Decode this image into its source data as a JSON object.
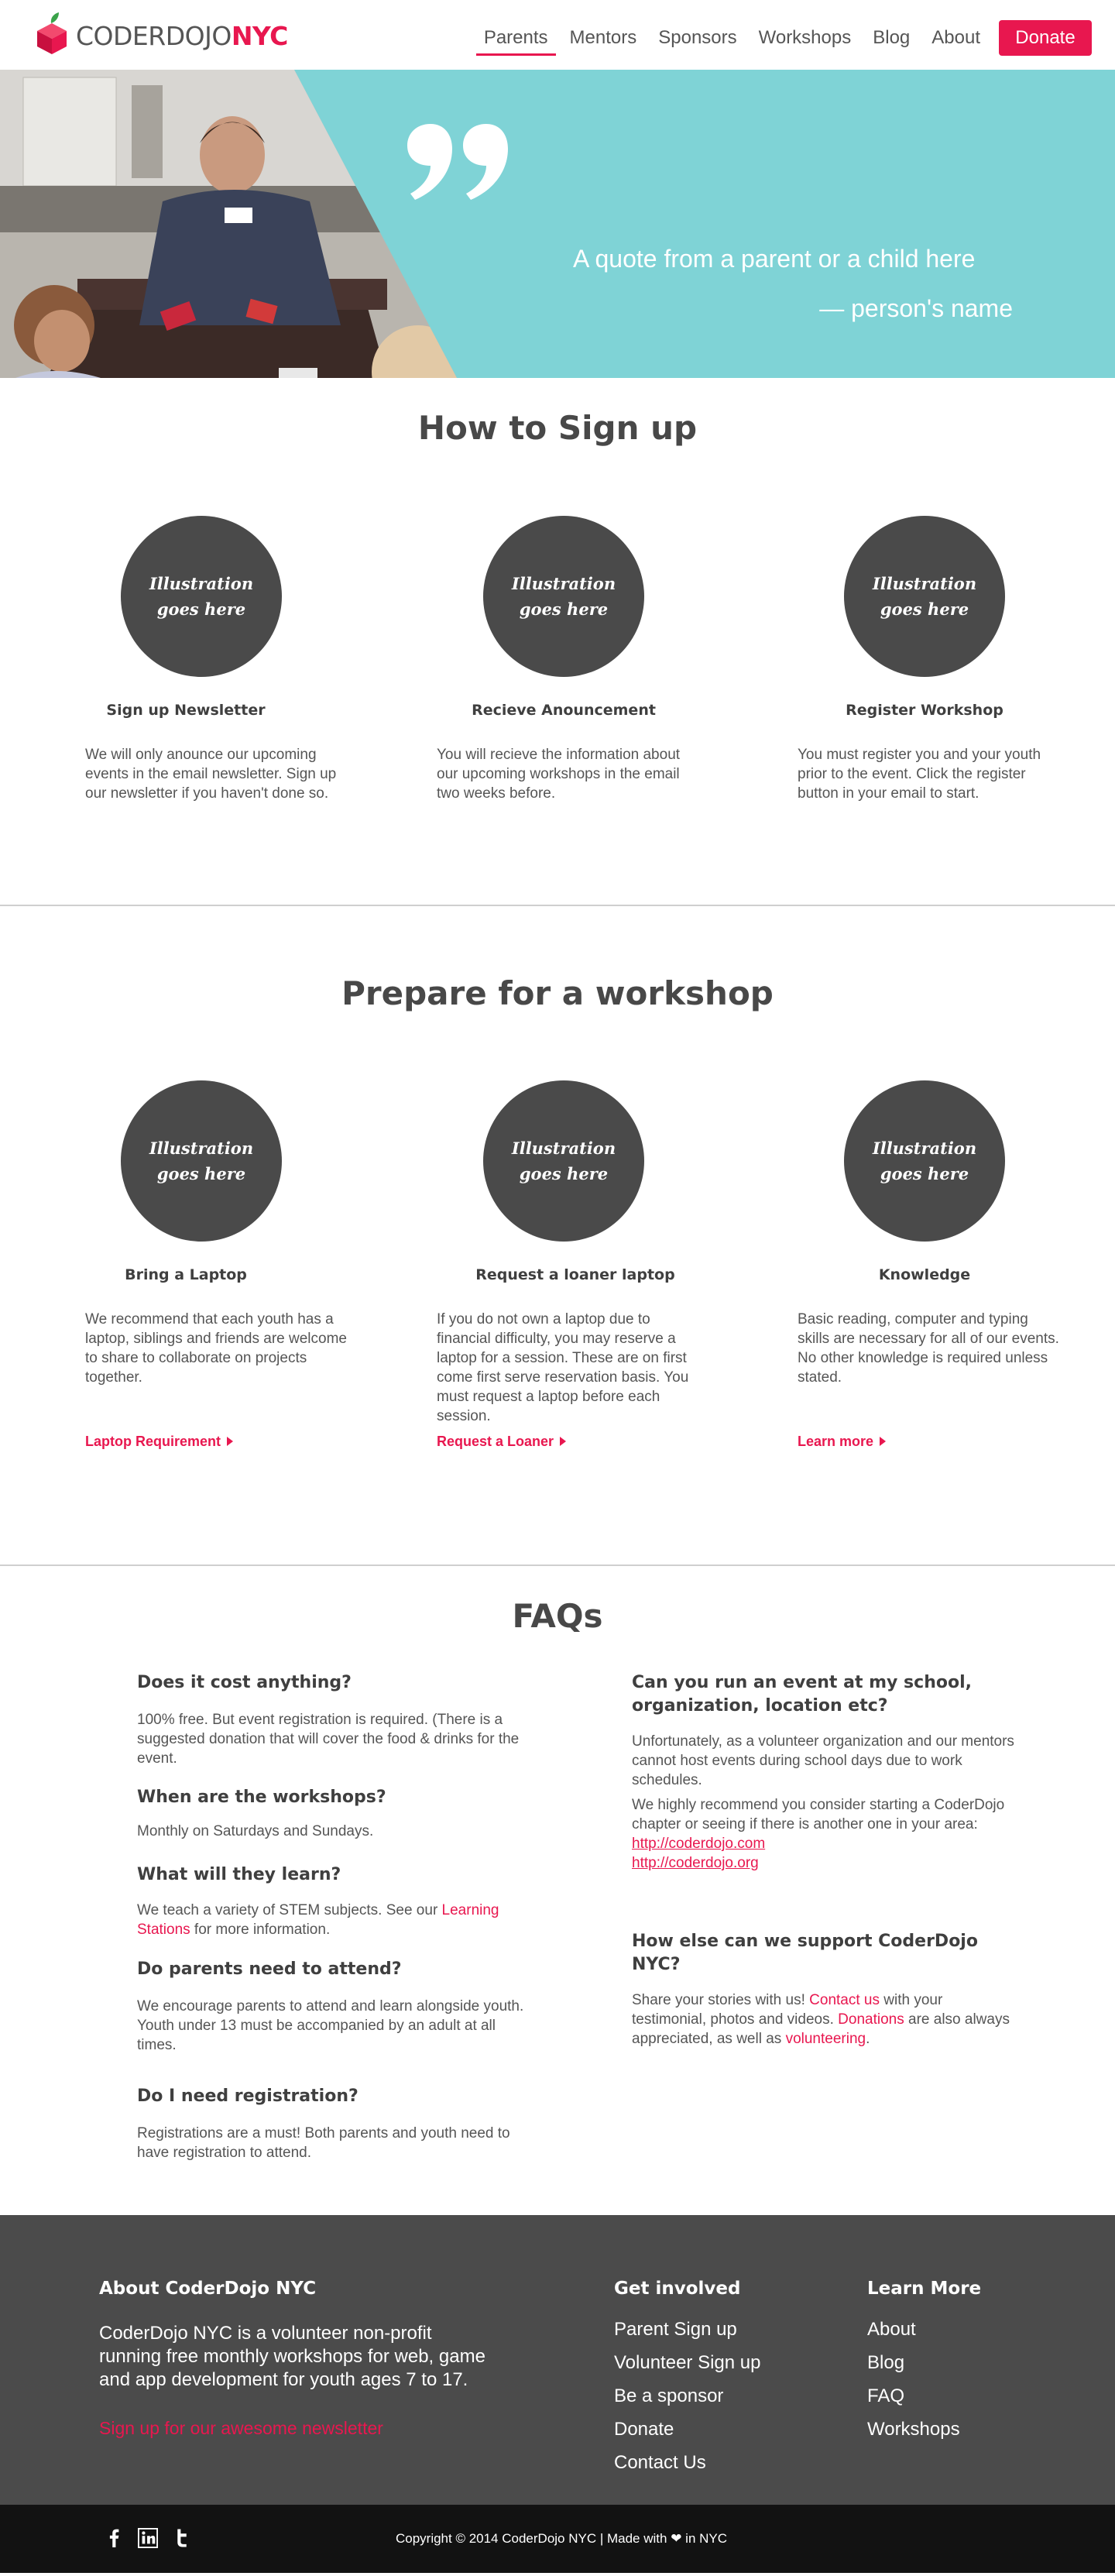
{
  "brand": {
    "logo_main": "CODERDOJO",
    "logo_accent": "NYC",
    "accent_color": "#e8174f",
    "hero_color": "#7fd3d6"
  },
  "nav": {
    "items": [
      "Parents",
      "Mentors",
      "Sponsors",
      "Workshops",
      "Blog",
      "About"
    ],
    "active": "Parents",
    "donate_label": "Donate"
  },
  "hero": {
    "quote_icon": "quote-mark-icon",
    "quote": "A quote from a parent or a child here",
    "author": "— person's name"
  },
  "signup": {
    "title": "How to Sign up",
    "cards": [
      {
        "illustration": "Illustration goes here",
        "title": "Sign up Newsletter",
        "text": "We will only anounce our upcoming events in the email newsletter. Sign up our newsletter if you haven't done so."
      },
      {
        "illustration": "Illustration goes here",
        "title": "Recieve Anouncement",
        "text": "You will recieve the information about our upcoming workshops in the email two weeks before."
      },
      {
        "illustration": "Illustration goes here",
        "title": "Register Workshop",
        "text": "You must register you and your youth prior to the event. Click the register button in your email to start."
      }
    ]
  },
  "prepare": {
    "title": "Prepare for a workshop",
    "cards": [
      {
        "illustration": "Illustration goes here",
        "title": "Bring a Laptop",
        "text": "We recommend that each youth has a laptop, siblings and friends are welcome to share to collaborate on projects together.",
        "link": "Laptop Requirement"
      },
      {
        "illustration": "Illustration goes here",
        "title": "Request a loaner laptop",
        "text": "If you do not own a laptop due to financial difficulty, you may reserve a laptop for a session. These are on first come first serve reservation basis. You must request a laptop before each session.",
        "link": "Request a Loaner"
      },
      {
        "illustration": "Illustration goes here",
        "title": "Knowledge",
        "text": "Basic reading, computer and typing skills are necessary for all of our events. No other knowledge is required unless stated.",
        "link": "Learn more"
      }
    ]
  },
  "faq": {
    "title": "FAQs",
    "q1": "Does it cost anything?",
    "a1": "100% free. But event registration is required. (There is a suggested donation that will cover the food & drinks for the event.",
    "q2": "When are the workshops?",
    "a2": "Monthly on Saturdays and Sundays.",
    "q3": "What will they learn?",
    "a3_pre": "We teach a variety of STEM subjects. See our ",
    "a3_link": "Learning Stations",
    "a3_post": " for more information.",
    "q4": "Do parents need to attend?",
    "a4": "We encourage parents to attend and learn alongside youth. Youth under 13 must be accompanied by an adult at all times.",
    "q5": "Do I need registration?",
    "a5": "Registrations are a must! Both parents and youth need to have registration to attend.",
    "q6": "Can you run an event at my school, organization, location etc?",
    "a6": "Unfortunately, as a volunteer organization and our mentors cannot host events during school days due to work schedules.",
    "a6b": "We highly recommend you consider starting a CoderDojo chapter or seeing if there is another one in your area:",
    "a6_link1": "http://coderdojo.com",
    "a6_link2": "http://coderdojo.org",
    "q7": "How else can we support CoderDojo NYC?",
    "a7_1": "Share your stories with us! ",
    "a7_link1": "Contact us",
    "a7_2": " with your testimonial, photos and videos. ",
    "a7_link2": "Donations",
    "a7_3": " are also always appreciated, as well as ",
    "a7_link3": "volunteering",
    "a7_4": "."
  },
  "footer": {
    "about_title": "About CoderDojo NYC",
    "about_text": "CoderDojo NYC is a volunteer non-profit running free monthly workshops for web, game and app development for youth ages 7 to 17.",
    "newsletter_link": "Sign up for our awesome newsletter",
    "involved_title": "Get involved",
    "involved": [
      "Parent Sign up",
      "Volunteer Sign up",
      "Be a sponsor",
      "Donate",
      "Contact Us"
    ],
    "learn_title": "Learn More",
    "learn": [
      "About",
      "Blog",
      "FAQ",
      "Workshops"
    ],
    "social_icons": [
      "facebook-icon",
      "linkedin-icon",
      "twitter-icon"
    ],
    "copyright_pre": "Copyright © 2014 CoderDojo NYC | Made with ",
    "heart_icon": "❤",
    "copyright_post": " in NYC"
  }
}
